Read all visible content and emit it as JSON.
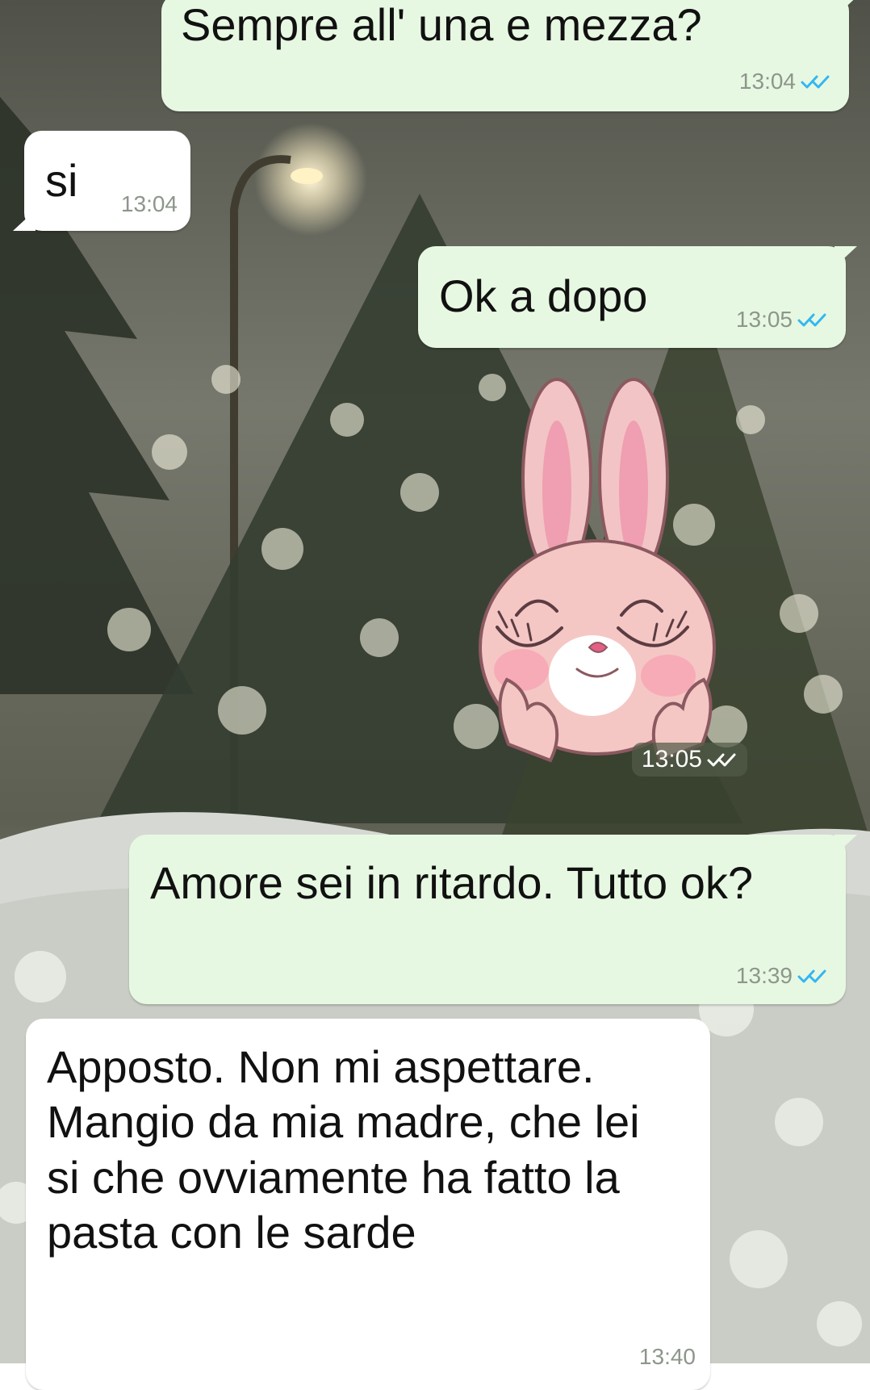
{
  "colors": {
    "outgoing_bubble": "#e7f8e2",
    "incoming_bubble": "#ffffff",
    "read_tick": "#34b7f1",
    "sent_tick": "#8d968b",
    "timestamp": "#8d968b"
  },
  "messages": [
    {
      "direction": "outgoing",
      "text": "Sempre all' una e mezza?",
      "time": "13:04",
      "status_icon": "double-check-icon"
    },
    {
      "direction": "incoming",
      "text": "si",
      "time": "13:04"
    },
    {
      "direction": "outgoing",
      "text": "Ok a dopo",
      "time": "13:05",
      "status_icon": "double-check-icon"
    },
    {
      "direction": "outgoing",
      "type": "sticker",
      "sticker_icon": "pink-bunny-sticker-icon",
      "time": "13:05",
      "status_icon": "double-check-icon"
    },
    {
      "direction": "outgoing",
      "text": "Amore sei in ritardo. Tutto ok?",
      "time": "13:39",
      "status_icon": "double-check-icon"
    },
    {
      "direction": "incoming",
      "text": "Apposto. Non mi aspettare. Mangio da mia madre, che lei si che ovviamente ha fatto la pasta con le sarde",
      "time": "13:40"
    }
  ]
}
